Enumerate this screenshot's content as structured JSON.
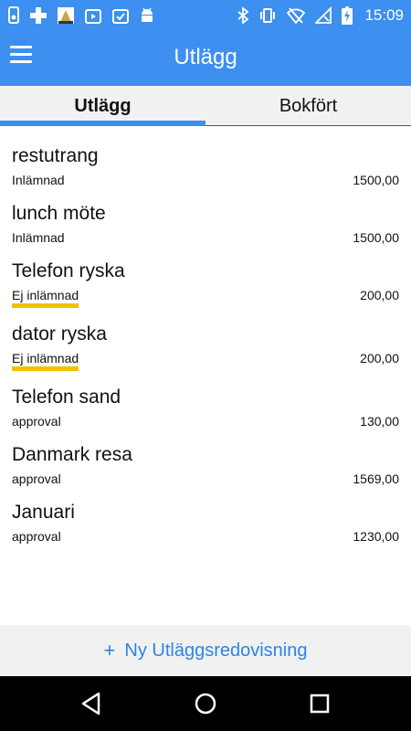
{
  "status_bar": {
    "time": "15:09",
    "left_icons": [
      "phone-debug-icon",
      "medical-cross-icon",
      "photo-thumb-icon",
      "media-play-icon",
      "checkbox-app-icon",
      "android-icon"
    ],
    "right_icons": [
      "bluetooth-icon",
      "vibrate-icon",
      "wifi-off-icon",
      "no-signal-icon",
      "battery-charging-icon"
    ]
  },
  "app_bar": {
    "title": "Utlägg"
  },
  "tabs": [
    {
      "label": "Utlägg",
      "active": true
    },
    {
      "label": "Bokfört",
      "active": false
    }
  ],
  "expenses": [
    {
      "title": "restutrang",
      "status": "Inlämnad",
      "amount": "1500,00"
    },
    {
      "title": "lunch möte",
      "status": "Inlämnad",
      "amount": "1500,00"
    },
    {
      "title": "Telefon ryska",
      "status": "Ej inlämnad",
      "amount": "200,00"
    },
    {
      "title": "dator ryska",
      "status": "Ej inlämnad",
      "amount": "200,00"
    },
    {
      "title": "Telefon sand",
      "status": "approval",
      "amount": "130,00"
    },
    {
      "title": "Danmark resa",
      "status": "approval",
      "amount": "1569,00"
    },
    {
      "title": "Januari",
      "status": "approval",
      "amount": "1230,00"
    }
  ],
  "new_button": {
    "plus": "+",
    "label": "Ny Utläggsredovisning"
  },
  "colors": {
    "primary": "#3d8ff0",
    "link": "#2a85e8",
    "warning_underline": "#f2c200",
    "tab_bg": "#f1f1f1"
  }
}
